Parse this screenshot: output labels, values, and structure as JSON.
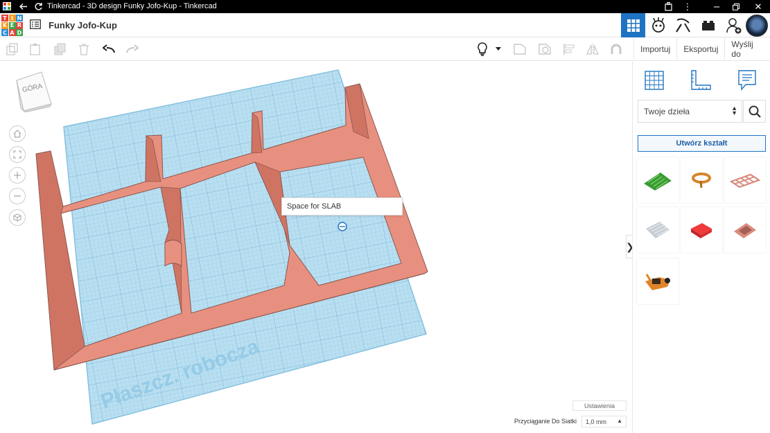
{
  "window": {
    "title": "Tinkercad - 3D design Funky Jofo-Kup - Tinkercad"
  },
  "header": {
    "logo_letters": [
      "TIN",
      "KER",
      "CAD"
    ],
    "project_title": "Funky Jofo-Kup",
    "views": [
      "3d-design-view",
      "circuits-view",
      "codeblocks-view",
      "blocks-view"
    ]
  },
  "toolbar": {
    "import_label": "Importuj",
    "export_label": "Eksportuj",
    "send_label": "Wyślij do"
  },
  "canvas": {
    "viewcube_label": "GÓRA",
    "workplane_label": "Płaszcz. robocza",
    "tooltip_text": "Space for SLAB",
    "settings_label": "Ustawienia",
    "snap_label": "Przyciąganie Do Siatki",
    "snap_value": "1,0 mm"
  },
  "panel": {
    "library_select": "Twoje dzieła",
    "create_shape_label": "Utwórz kształt",
    "shapes": [
      "green-terrain",
      "orange-ring",
      "pink-grid-frame",
      "gray-slab",
      "red-box",
      "pink-plate",
      "orange-mechanism"
    ]
  },
  "colors": {
    "accent": "#1e74c2",
    "workplane": "#b9dff1",
    "model": "#e8907f",
    "logo_red": "#e2423b",
    "logo_orange": "#f59a23",
    "logo_blue": "#2a8fd8",
    "logo_green": "#3aa54a"
  }
}
